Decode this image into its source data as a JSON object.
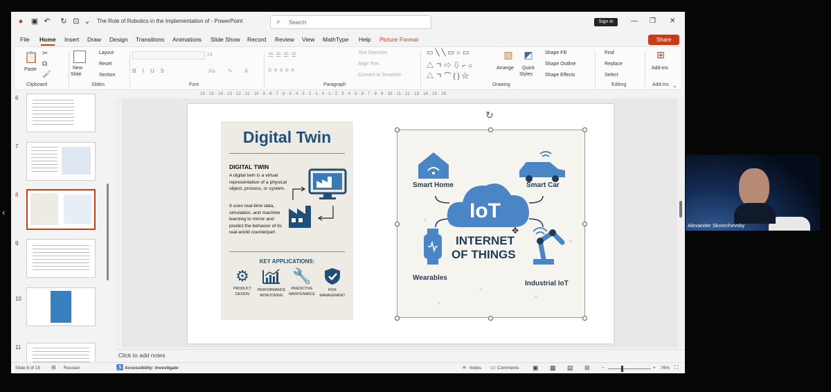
{
  "titlebar": {
    "doc_title": "The Role of Robotics in the Implementation of  -  PowerPoint",
    "search_placeholder": "Search",
    "signin_label": "Sign in"
  },
  "tabs": [
    "File",
    "Home",
    "Insert",
    "Draw",
    "Design",
    "Transitions",
    "Animations",
    "Slide Show",
    "Record",
    "Review",
    "View",
    "MathType",
    "Help",
    "Picture Format"
  ],
  "share_label": "Share",
  "ribbon": {
    "clipboard": {
      "group": "Clipboard",
      "paste": "Paste"
    },
    "slides": {
      "group": "Slides",
      "new_slide_1": "New",
      "new_slide_2": "Slide",
      "layout": "Layout",
      "reset": "Reset",
      "section": "Section"
    },
    "font": {
      "group": "Font",
      "size": "24"
    },
    "paragraph": {
      "group": "Paragraph",
      "text_direction": "Text Direction",
      "align_text": "Align Text",
      "convert": "Convert to SmartArt"
    },
    "drawing": {
      "group": "Drawing",
      "arrange": "Arrange",
      "quick_1": "Quick",
      "quick_2": "Styles",
      "fill": "Shape Fill",
      "outline": "Shape Outline",
      "effects": "Shape Effects"
    },
    "editing": {
      "group": "Editing",
      "find": "Find",
      "replace": "Replace",
      "select": "Select"
    },
    "addins": {
      "group": "Add-ins",
      "label": "Add-ins"
    }
  },
  "thumbnails": [
    {
      "num": "6"
    },
    {
      "num": "7"
    },
    {
      "num": "8",
      "selected": true
    },
    {
      "num": "9"
    },
    {
      "num": "10"
    },
    {
      "num": "11"
    }
  ],
  "ruler_text": "16 · 15 · 14 · 13 · 12 · 11 · 10 · 9 · 8 · 7 · 6 · 5 · 4 · 3 · 2 · 1 · 0 · 1 · 2 · 3 · 4 · 5 · 6 · 7 · 8 · 9 · 10 · 11 · 12 · 13 · 14 · 15 · 16",
  "slide": {
    "digital_twin": {
      "title": "Digital Twin",
      "heading": "DIGITAL TWIN",
      "para1": "A digital twin is a virtual representation of a physical object, process, or system.",
      "para2": "It uses real-time data, simulation, and machine learning to mirror and predict the behavior of its real-world counterpart.",
      "key_apps": "KEY APPLICATIONS:",
      "apps": [
        {
          "l1": "PRODUCT",
          "l2": "DESIGN",
          "icon": "gear-icon"
        },
        {
          "l1": "PERFORMANCE",
          "l2": "MONITORING",
          "icon": "chart-icon"
        },
        {
          "l1": "PREDICTIVE",
          "l2": "MAINTENANCE",
          "icon": "wrench-icon"
        },
        {
          "l1": "RISK",
          "l2": "MANAGEMENT",
          "icon": "shield-check-icon"
        }
      ]
    },
    "iot": {
      "cloud_text": "IoT",
      "line1": "INTERNET",
      "line2": "OF THINGS",
      "smart_home": "Smart Home",
      "smart_car": "Smart Car",
      "wearables": "Wearables",
      "industrial": "Industrial IoT"
    }
  },
  "notes_placeholder": "Click to add notes",
  "status": {
    "slide_of": "Slide 8 of 15",
    "language": "Russian",
    "accessibility": "Accessibility: Investigate",
    "notes": "Notes",
    "comments": "Comments",
    "zoom": "76%"
  },
  "video": {
    "participant_name": "Alexander Skvorchevsky"
  },
  "colors": {
    "accent": "#c43e1c",
    "slide_blue": "#1f4e79",
    "iot_blue": "#4a86c5"
  }
}
